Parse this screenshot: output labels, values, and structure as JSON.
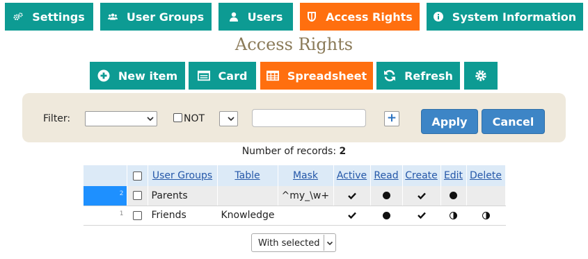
{
  "tabs": [
    {
      "label": "Settings",
      "icon": "gears-icon",
      "active": false
    },
    {
      "label": "User Groups",
      "icon": "users-icon",
      "active": false
    },
    {
      "label": "Users",
      "icon": "user-icon",
      "active": false
    },
    {
      "label": "Access Rights",
      "icon": "shield-icon",
      "active": true
    },
    {
      "label": "System Information",
      "icon": "info-icon",
      "active": false
    }
  ],
  "page_title": "Access Rights",
  "toolbar": {
    "new_item": "New item",
    "card": "Card",
    "spreadsheet": "Spreadsheet",
    "refresh": "Refresh",
    "settings_icon": "gear-icon"
  },
  "filter": {
    "label": "Filter:",
    "field_value": "",
    "not_label": "NOT",
    "operator_value": "",
    "text_value": "",
    "apply": "Apply",
    "cancel": "Cancel"
  },
  "records": {
    "label": "Number of records:",
    "count": "2"
  },
  "table": {
    "columns": [
      "User Groups",
      "Table",
      "Mask",
      "Active",
      "Read",
      "Create",
      "Edit",
      "Delete"
    ],
    "rows": [
      {
        "num": "2",
        "user_group": "Parents",
        "table": "",
        "mask": "^my_\\w+",
        "active": "check",
        "read": "full",
        "create": "check",
        "edit": "full",
        "delete": "",
        "selected": true
      },
      {
        "num": "1",
        "user_group": "Friends",
        "table": "Knowledge",
        "mask": "",
        "active": "check",
        "read": "full",
        "create": "check",
        "edit": "half",
        "delete": "half",
        "selected": false
      }
    ]
  },
  "with_selected": "With selected",
  "colors": {
    "teal": "#0d9b93",
    "orange": "#ff6f0f",
    "blue": "#3d85c6",
    "filter_bg": "#efe9dc",
    "select_row": "#1e90ff"
  }
}
